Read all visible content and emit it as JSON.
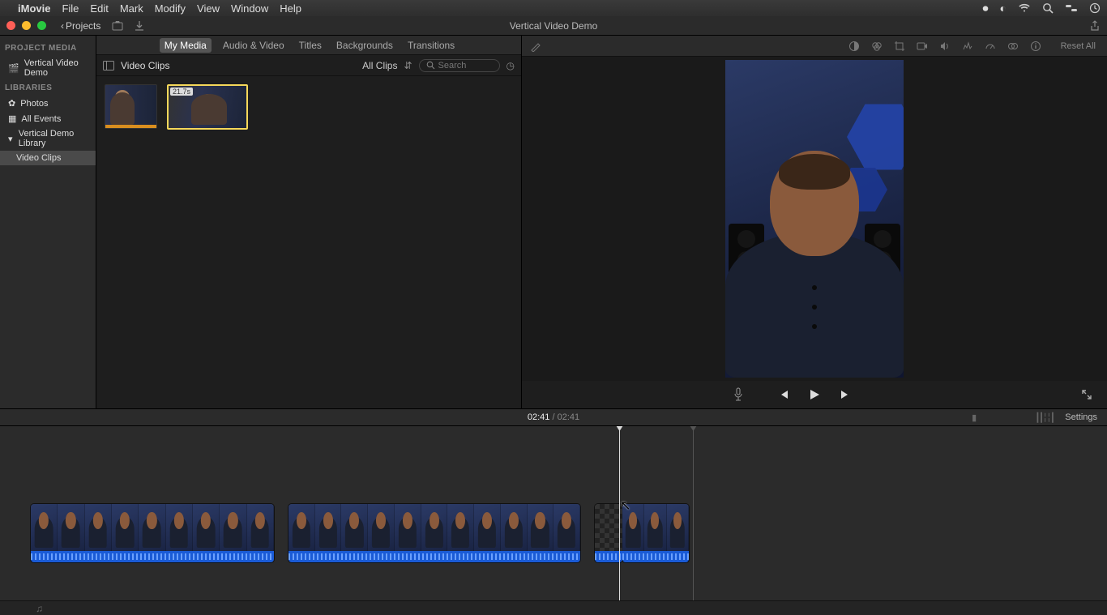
{
  "menubar": {
    "app": "iMovie",
    "items": [
      "File",
      "Edit",
      "Mark",
      "Modify",
      "View",
      "Window",
      "Help"
    ],
    "status_icons": [
      "screen-record-icon",
      "obs-icon",
      "wifi-icon",
      "search-icon",
      "control-center-icon",
      "clock-icon"
    ]
  },
  "toolbar": {
    "back_label": "Projects",
    "window_title": "Vertical Video Demo"
  },
  "sidebar": {
    "project_hdr": "PROJECT MEDIA",
    "project_name": "Vertical Video Demo",
    "libraries_hdr": "LIBRARIES",
    "photos": "Photos",
    "all_events": "All Events",
    "library": "Vertical Demo Library",
    "event": "Video Clips"
  },
  "browser": {
    "tabs": [
      "My Media",
      "Audio & Video",
      "Titles",
      "Backgrounds",
      "Transitions"
    ],
    "active_tab": "My Media",
    "left_label": "Video Clips",
    "filter": "All Clips",
    "search_placeholder": "Search",
    "clip_duration_badge": "21.7s"
  },
  "viewer": {
    "reset_label": "Reset All",
    "adjust_icons": [
      "color-balance-icon",
      "color-correct-icon",
      "crop-icon",
      "stabilize-icon",
      "volume-icon",
      "noise-icon",
      "speed-icon",
      "filter-icon",
      "info-icon"
    ]
  },
  "playback": {
    "current": "02:41",
    "sep": " / ",
    "total": "02:41",
    "settings_label": "Settings"
  },
  "colors": {
    "accent_select": "#f5d85a",
    "audio_blue": "#1a5bd6"
  }
}
